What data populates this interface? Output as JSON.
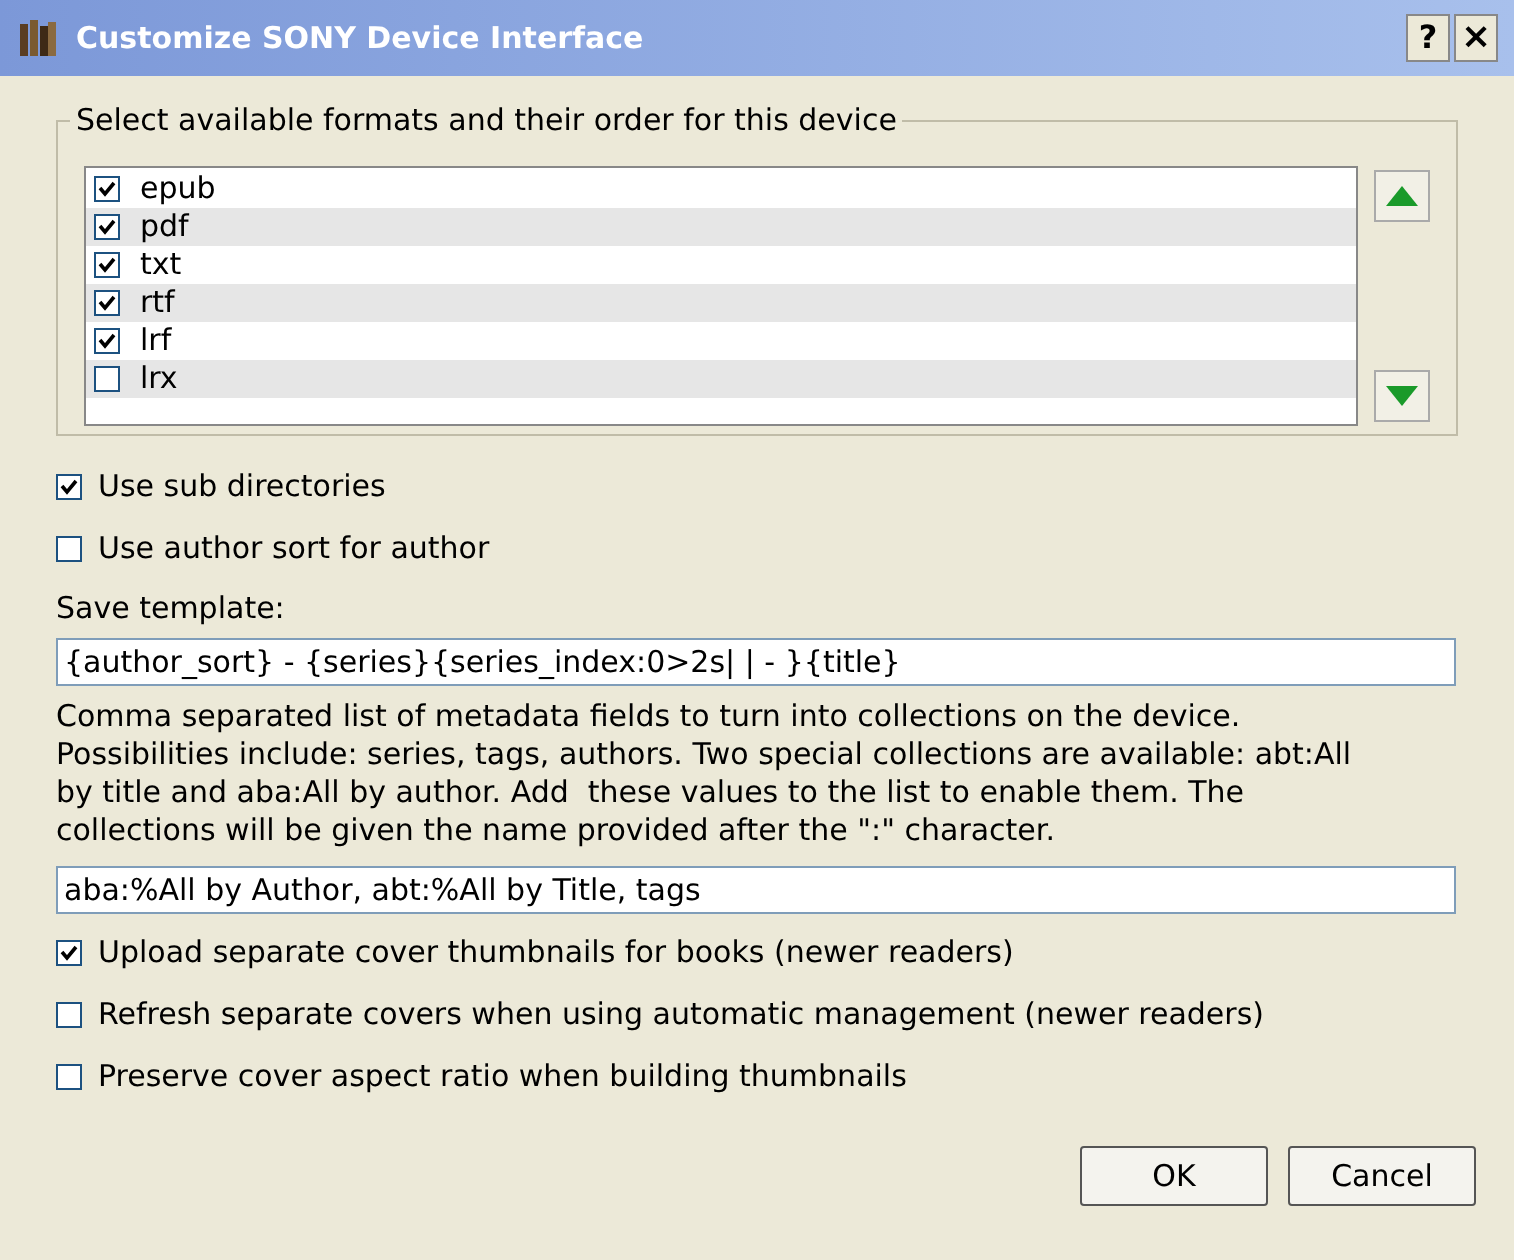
{
  "window": {
    "title": "Customize SONY Device Interface",
    "help_button": "?",
    "close_button": "×"
  },
  "formats": {
    "title": "Select available formats and their order for this device",
    "items": [
      {
        "label": "epub",
        "checked": true
      },
      {
        "label": "pdf",
        "checked": true
      },
      {
        "label": "txt",
        "checked": true
      },
      {
        "label": "rtf",
        "checked": true
      },
      {
        "label": "lrf",
        "checked": true
      },
      {
        "label": "lrx",
        "checked": false
      }
    ]
  },
  "options_top": [
    {
      "label": "Use sub directories",
      "checked": true
    },
    {
      "label": "Use author sort for author",
      "checked": false
    }
  ],
  "save_template": {
    "label": "Save template:",
    "value": "{author_sort} - {series}{series_index:0>2s| | - }{title}"
  },
  "collections": {
    "help_lines": [
      "Comma separated list of metadata fields to turn into collections on the device.",
      "Possibilities include: series, tags, authors. Two special collections are available: abt:All",
      "by title and aba:All by author. Add  these values to the list to enable them. The",
      "collections will be given the name provided after the \":\" character."
    ],
    "value": "aba:%All by Author, abt:%All by Title, tags"
  },
  "options_bottom": [
    {
      "label": "Upload separate cover thumbnails for books (newer readers)",
      "checked": true
    },
    {
      "label": "Refresh separate covers when using automatic management (newer readers)",
      "checked": false
    },
    {
      "label": "Preserve cover aspect ratio when building thumbnails",
      "checked": false
    }
  ],
  "buttons": [
    "OK",
    "Cancel"
  ]
}
